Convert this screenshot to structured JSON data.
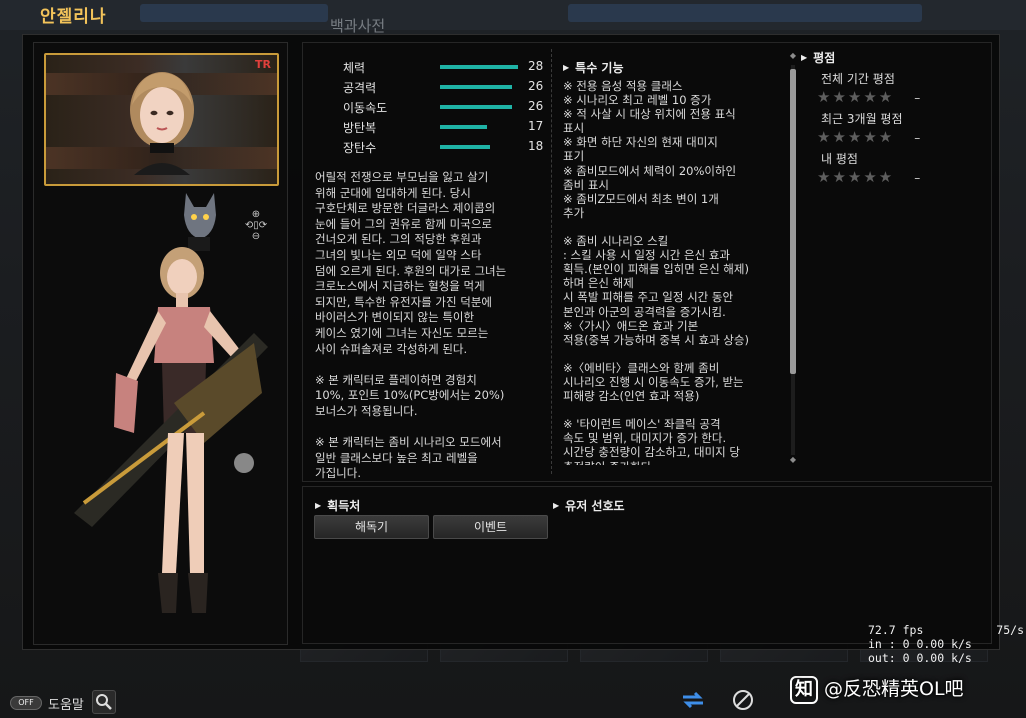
{
  "character": {
    "name": "안젤리나",
    "badge": "TR"
  },
  "background": {
    "section_title": "백과사전"
  },
  "stats": [
    {
      "label": "체력",
      "value": 28,
      "fill": 0.78
    },
    {
      "label": "공격력",
      "value": 26,
      "fill": 0.72
    },
    {
      "label": "이동속도",
      "value": 26,
      "fill": 0.72
    },
    {
      "label": "방탄복",
      "value": 17,
      "fill": 0.47
    },
    {
      "label": "장탄수",
      "value": 18,
      "fill": 0.5
    }
  ],
  "story": "어릴적 전쟁으로 부모님을 잃고 살기\n위해 군대에 입대하게 된다. 당시\n구호단체로 방문한 더글라스 제이콥의\n눈에 들어 그의 권유로 함께 미국으로\n건너오게 된다. 그의 적당한 후원과\n그녀의 빛나는 외모 덕에 일약 스타\n덤에 오르게 된다. 후원의 대가로 그녀는\n 크로노스에서 지급하는 혈청을 먹게\n되지만, 특수한 유전자를 가진 덕분에\n바이러스가 변이되지 않는 특이한\n케이스 였기에 그녀는 자신도 모르는\n사이 슈퍼솔져로 각성하게 된다.\n\n※ 본 캐릭터로 플레이하면 경험치\n10%, 포인트 10%(PC방에서는 20%)\n보너스가 적용됩니다.\n\n※ 본 캐릭터는 좀비 시나리오 모드에서\n 일반 클래스보다 높은 최고 레벨을\n가집니다.",
  "special": {
    "title": "특수 기능",
    "text": "※ 전용 음성 적용 클래스\n※ 시나리오 최고 레벨 10 증가\n※ 적 사살 시 대상 위치에 전용 표식\n 표시\n※ 화면 하단 자신의 현재 대미지\n표기\n※ 좀비모드에서 체력이 20%이하인\n좀비 표시\n※ 좀비Z모드에서 최초 변이 1개\n추가\n\n※ 좀비 시나리오 스킬\n: 스킬 사용 시 일정 시간 은신 효과\n획득.(본인이 피해를 입히면 은신 해제)\n하며 은신 해제\n시 폭발 피해를 주고 일정 시간 동안\n본인과 아군의 공격력을 증가시킴.\n※〈가시〉애드온 효과 기본\n적용(중복 가능하며 중복 시 효과 상승)\n\n※〈에비타〉클래스와 함께 좀비\n시나리오 진행 시 이동속도 증가, 받는\n피해량 감소(인연 효과 적용)\n\n※ '타이런트 메이스' 좌클릭 공격\n속도 및 범위, 대미지가 증가 한다.\n시간당 충전량이 감소하고, 대미지 당\n충전량이 증가한다."
  },
  "rating": {
    "title": "평점",
    "rows": [
      {
        "label": "전체 기간 평점",
        "stars": "★★★★★",
        "value": "–"
      },
      {
        "label": "최근 3개월 평점",
        "stars": "★★★★★",
        "value": "–"
      },
      {
        "label": "내 평점",
        "stars": "★★★★★",
        "value": "–"
      }
    ]
  },
  "acquire": {
    "title": "획득처",
    "buttons": [
      "해독기",
      "이벤트"
    ]
  },
  "preference": {
    "title": "유저 선호도"
  },
  "hud": {
    "toggle": "OFF",
    "help": "도움말"
  },
  "net": {
    "fps": "72.7 fps",
    "rate": "75/s",
    "in": "in : 0 0.00 k/s",
    "out": "out: 0 0.00 k/s"
  },
  "watermark": {
    "badge": "知",
    "text": "@反恐精英OL吧"
  },
  "colors": {
    "name": "#f2c35a",
    "stat_bar": "#1fb3a6",
    "portrait_frame": "#c99b3a",
    "badge": "#e0403c"
  }
}
